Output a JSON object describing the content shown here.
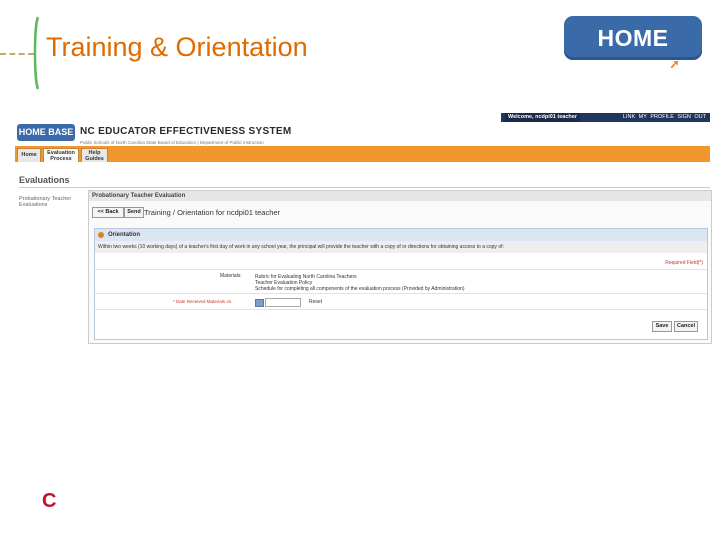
{
  "slide": {
    "title": "Training & Orientation",
    "logo_text": "HOME BASE",
    "corner_letter": "C"
  },
  "colors": {
    "title": "#e06a00",
    "logo": "#3a6aa8",
    "app_bar": "#f0962d",
    "top_bar": "#20365a",
    "required": "#c0392b"
  },
  "app": {
    "welcome": "Welcome, ncdpi01 teacher",
    "top_links": [
      "LINK",
      "MY PROFILE",
      "SIGN OUT"
    ],
    "logo_text": "HOME BASE",
    "title": "NC EDUCATOR EFFECTIVENESS SYSTEM",
    "subtitle": "Public Schools of North Carolina  State Board of Education | Department of Public Instruction",
    "tabs": [
      "Home",
      "Evaluation Process",
      "Help Guides"
    ],
    "section_title": "Evaluations",
    "sidenav_item": "Probationary Teacher Evaluations",
    "panel_header": "Probationary Teacher Evaluation",
    "back_button": "<< Back",
    "send_button": "Send",
    "breadcrumb": "Training / Orientation for ncdpi01 teacher",
    "orientation_header": "Orientation",
    "instructions": "Within two weeks (10 working days) of a teacher's first day of work in any school year, the principal will provide the teacher with a copy of or directions for obtaining access to a copy of:",
    "required_note": "Required Field(*)",
    "materials_label": "Materials:",
    "materials": [
      "Rubric for Evaluating North Carolina Teachers",
      "Teacher Evaluation Policy",
      "Schedule for completing all components of the evaluation process (Provided by Administration)"
    ],
    "date_label": "* Date Received Materials on",
    "reset_label": "Reset",
    "save_button": "Save",
    "cancel_button": "Cancel"
  }
}
